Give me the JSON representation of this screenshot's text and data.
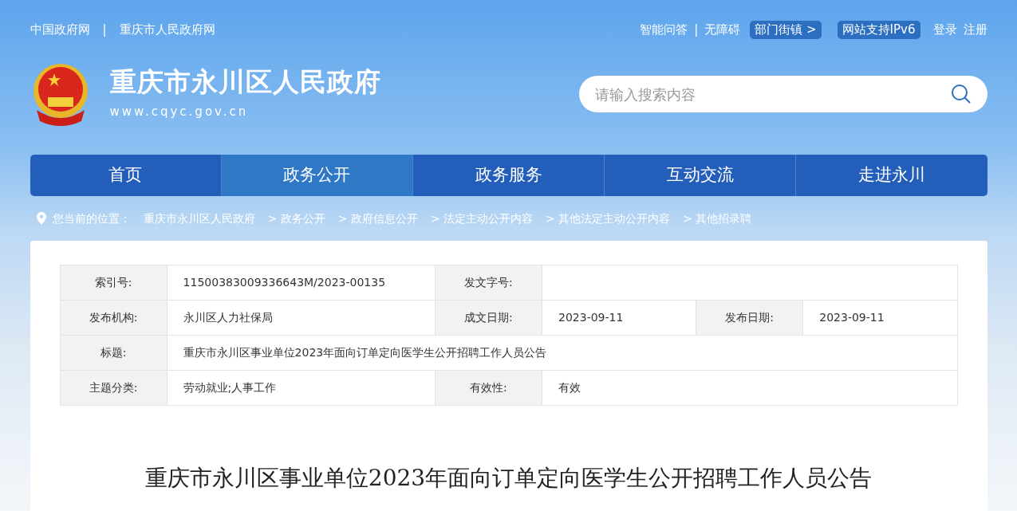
{
  "top_links_left": [
    "中国政府网",
    "|",
    "重庆市人民政府网"
  ],
  "top_links_right": [
    {
      "text": "智能问答",
      "kind": "link"
    },
    {
      "text": "|",
      "kind": "sep"
    },
    {
      "text": "无障碍",
      "kind": "link"
    },
    {
      "text": "部门街镇 >",
      "kind": "pill"
    },
    {
      "text": "网站支持IPv6",
      "kind": "pill"
    },
    {
      "text": "登录",
      "kind": "link"
    },
    {
      "text": "注册",
      "kind": "link"
    }
  ],
  "site": {
    "title": "重庆市永川区人民政府",
    "url": "www.cqyc.gov.cn"
  },
  "search": {
    "placeholder": "请输入搜索内容"
  },
  "nav": [
    {
      "label": "首页",
      "selected": false
    },
    {
      "label": "政务公开",
      "selected": true
    },
    {
      "label": "政务服务",
      "selected": false
    },
    {
      "label": "互动交流",
      "selected": false
    },
    {
      "label": "走进永川",
      "selected": false
    }
  ],
  "breadcrumb": {
    "label": "您当前的位置：",
    "items": [
      "重庆市永川区人民政府",
      "> 政务公开",
      "> 政府信息公开",
      "> 法定主动公开内容",
      "> 其他法定主动公开内容",
      "> 其他招录聘"
    ]
  },
  "info_table": [
    [
      {
        "kind": "label",
        "text": "索引号:"
      },
      {
        "kind": "value",
        "text": "11500383009336643M/2023-00135"
      },
      {
        "kind": "label",
        "text": "发文字号:"
      },
      {
        "kind": "value"
      }
    ],
    [
      {
        "kind": "label",
        "text": "发布机构:"
      },
      {
        "kind": "value",
        "text": "永川区人力社保局"
      },
      {
        "kind": "label",
        "text": "成文日期:"
      },
      {
        "kind": "value",
        "text": "2023-09-11"
      },
      {
        "kind": "label",
        "text": "发布日期:"
      },
      {
        "kind": "value",
        "text": "2023-09-11"
      }
    ],
    [
      {
        "kind": "label",
        "text": "标题:"
      },
      {
        "kind": "value",
        "text": "重庆市永川区事业单位2023年面向订单定向医学生公开招聘工作人员公告"
      }
    ],
    [
      {
        "kind": "label",
        "text": "主题分类:"
      },
      {
        "kind": "value",
        "text": "劳动就业;人事工作"
      },
      {
        "kind": "label",
        "text": "有效性:"
      },
      {
        "kind": "value",
        "text": "有效"
      }
    ]
  ],
  "article": {
    "title": "重庆市永川区事业单位2023年面向订单定向医学生公开招聘工作人员公告"
  }
}
